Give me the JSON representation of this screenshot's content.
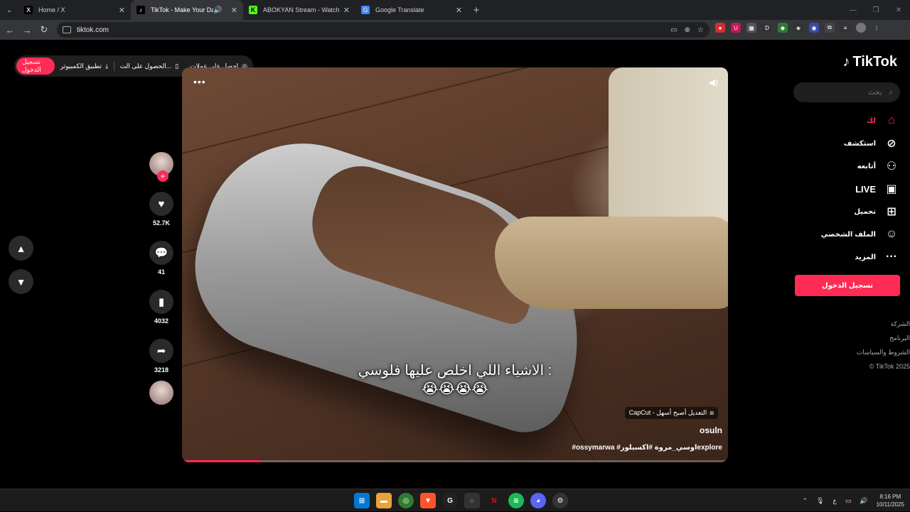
{
  "browser": {
    "tabs": [
      {
        "title": "Home / X",
        "favicon": "X",
        "favicon_color": "#000000",
        "active": false
      },
      {
        "title": "TikTok - Make Your Day",
        "favicon": "♪",
        "favicon_color": "#000000",
        "active": true
      },
      {
        "title": "ABOKYAN Stream - Watch Live",
        "favicon": "K",
        "favicon_color": "#53fc18",
        "active": false
      },
      {
        "title": "Google Translate",
        "favicon": "G",
        "favicon_color": "#4285f4",
        "active": false
      }
    ],
    "url": "tiktok.com"
  },
  "top_actions": {
    "login": "تسجيل الدخول",
    "pc_app": "تطبيق الكمبيوتر",
    "get_app": "الحصول على الت...",
    "coins": "احصل على عملات"
  },
  "video": {
    "caption_line1": "الاشياء اللي اخلص عليها فلوسي :",
    "caption_line2": "😭😭😭😭",
    "capcut": "CapCut - التعديل أصبح أسهل",
    "author": "osuln",
    "tags": "#ossymarwa #اوسي_مروة #اكسبلورexplore",
    "progress": 0.145
  },
  "actions": {
    "likes": "52.7K",
    "comments": "41",
    "saves": "4032",
    "shares": "3218"
  },
  "sidebar": {
    "logo": "TikTok",
    "search_placeholder": "بحث",
    "nav": [
      {
        "label": "لك",
        "icon": "home-icon",
        "active": true
      },
      {
        "label": "استكشف",
        "icon": "compass-icon",
        "active": false
      },
      {
        "label": "أتابعه",
        "icon": "following-icon",
        "active": false
      },
      {
        "label": "LIVE",
        "icon": "live-icon",
        "active": false
      },
      {
        "label": "تحميل",
        "icon": "upload-icon",
        "active": false
      },
      {
        "label": "الملف الشخصي",
        "icon": "profile-icon",
        "active": false
      },
      {
        "label": "المزيد",
        "icon": "more-icon",
        "active": false
      }
    ],
    "login": "تسجيل الدخول",
    "footer": [
      "الشركة",
      "البرنامج",
      "الشروط والسياسات",
      "© TikTok 2025"
    ]
  },
  "taskbar": {
    "time": "8:16 PM",
    "date": "10/11/2025",
    "lang": "ع"
  },
  "colors": {
    "accent": "#fe2c55"
  }
}
